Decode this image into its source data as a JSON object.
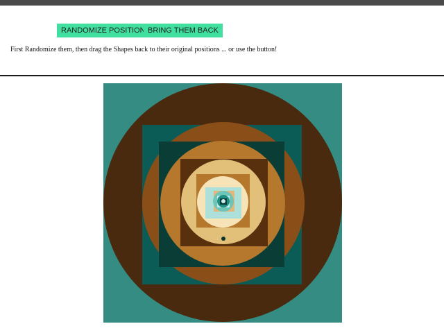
{
  "controls": {
    "randomize_label": "RANDOMIZE POSITIONS",
    "bring_back_label": "BRING THEM BACK",
    "instructions": "First Randomize them, then drag the Shapes back to their original positions ... or use the button!"
  },
  "palette": {
    "top_bar": "#4a4a4a",
    "button": "#41e0a0",
    "teal": "#348c83",
    "dark_brown": "#4a2a0e",
    "deep_teal": "#0b5b56",
    "rust": "#8a4f18",
    "darkest_teal": "#093d35",
    "ochre": "#b6782c",
    "chocolate": "#59300e",
    "sand": "#e2c07a",
    "tan": "#b5772c",
    "cream": "#f6e3b8",
    "light_aqua": "#aee0da",
    "peach": "#e2b77e",
    "mint": "#6cc5b5",
    "pale_aqua": "#c7ecea",
    "aqua": "#1f8f86",
    "ink": "#0b3b36",
    "dot": "#09332e"
  }
}
